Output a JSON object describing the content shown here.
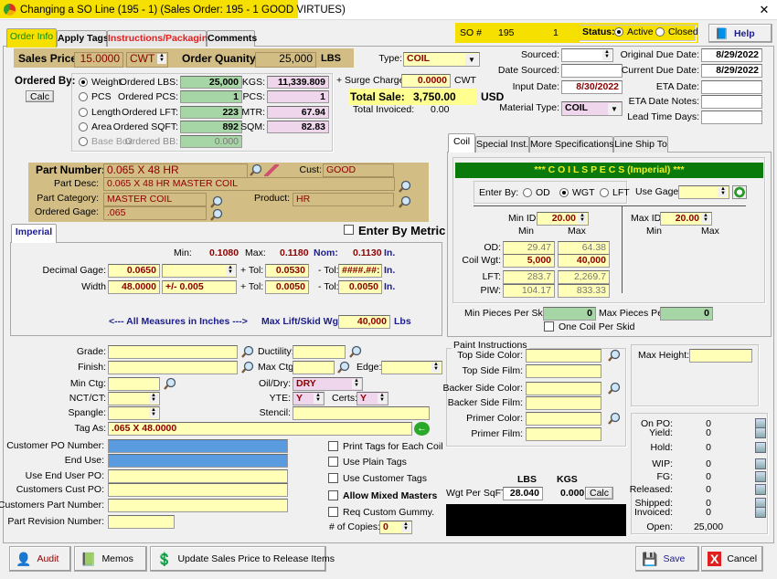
{
  "window": {
    "title": "Changing a SO Line  (195 - 1)  (Sales Order: 195 - 1    GOOD VIRTUES)",
    "close": "✕"
  },
  "tabs": [
    "Order Info",
    "Apply Tags",
    "Instructions/Packaging",
    "Comments"
  ],
  "so": {
    "label": "SO #",
    "number": "195",
    "line": "1",
    "status_label": "Status:",
    "active": "Active",
    "closed": "Closed",
    "status": "Active"
  },
  "help": "Help",
  "price": {
    "sales_price_label": "Sales Price:",
    "sales_price": "15.0000",
    "unit": "CWT",
    "qty_label": "Order Quanity:",
    "qty": "25,000",
    "qty_unit": "LBS"
  },
  "type": {
    "label": "Type:",
    "value": "COIL"
  },
  "ordered_by": {
    "label": "Ordered By:",
    "calc": "Calc",
    "selected": "Weight",
    "rows": [
      {
        "option": "Weight",
        "label": "Ordered LBS:",
        "value": "25,000",
        "metric_label": "KGS:",
        "metric": "11,339.809"
      },
      {
        "option": "PCS",
        "label": "Ordered PCS:",
        "value": "1",
        "metric_label": "PCS:",
        "metric": "1"
      },
      {
        "option": "Length",
        "label": "Ordered LFT:",
        "value": "223",
        "metric_label": "MTR:",
        "metric": "67.94"
      },
      {
        "option": "Area",
        "label": "Ordered SQFT:",
        "value": "892",
        "metric_label": "SQM:",
        "metric": "82.83"
      },
      {
        "option": "Base Box",
        "label": "Ordered BB:",
        "value": "0.000"
      }
    ]
  },
  "totals": {
    "surge_label": "+ Surge Charge:",
    "surge": "0.0000",
    "surge_unit": "CWT",
    "total_label": "Total Sale:",
    "total": "3,750.00",
    "currency": "USD",
    "invoiced_label": "Total Invoiced:",
    "invoiced": "0.00"
  },
  "dates": {
    "sourced_label": "Sourced:",
    "sourced": "",
    "date_sourced_label": "Date Sourced:",
    "date_sourced": "",
    "input_label": "Input Date:",
    "input": "8/30/2022",
    "material_label": "Material Type:",
    "material": "COIL",
    "orig_due_label": "Original Due Date:",
    "orig_due": "8/29/2022",
    "cur_due_label": "Current Due Date:",
    "cur_due": "8/29/2022",
    "eta_label": "ETA Date:",
    "eta": "",
    "eta_notes_label": "ETA Date Notes:",
    "eta_notes": "",
    "lead_label": "Lead Time Days:",
    "lead": ""
  },
  "part": {
    "number_label": "Part Number:",
    "number": "0.065 X 48 HR",
    "cust_label": "Cust:",
    "cust": "GOOD",
    "desc_label": "Part Desc:",
    "desc": "0.065 X 48 HR MASTER COIL",
    "category_label": "Part Category:",
    "category": "MASTER COIL",
    "product_label": "Product:",
    "product": "HR",
    "gage_label": "Ordered Gage:",
    "gage": ".065"
  },
  "metric": {
    "label": "Enter By Metric",
    "checked": false
  },
  "imperial": {
    "tab": "Imperial",
    "min_label": "Min:",
    "min": "0.1080",
    "max_label": "Max:",
    "max": "0.1180",
    "nom_label": "Nom:",
    "nom": "0.1130",
    "unit": "In.",
    "gage_label": "Decimal Gage:",
    "gage": "0.0650",
    "gage_tol_sel": "",
    "ptol_label": "+ Tol:",
    "gage_ptol": "0.0530",
    "mtol_label": "- Tol:",
    "gage_mtol": "####.##:",
    "width_label": "Width",
    "width": "48.0000",
    "width_tol_sel": "+/- 0.005",
    "width_ptol": "0.0050",
    "width_mtol": "0.0050",
    "measures_note": "<---  All Measures in Inches  --->",
    "maxlift_label": "Max Lift/Skid Wgt:",
    "maxlift": "40,000",
    "maxlift_unit": "Lbs"
  },
  "coil_tabs": [
    "Coil",
    "Special Inst.",
    "More Specifications",
    "Line Ship To"
  ],
  "coil": {
    "header": "***   C O I L    S P E C S   (Imperial)   ***",
    "enter_by_label": "Enter By:",
    "options": [
      "OD",
      "WGT",
      "LFT"
    ],
    "selected": "WGT",
    "use_gage_label": "Use Gage:",
    "use_gage": "",
    "min_id_label": "Min ID:",
    "min_id": "20.00",
    "max_id_label": "Max ID:",
    "max_id": "20.00",
    "min": "Min",
    "max": "Max",
    "rows": [
      {
        "label": "OD:",
        "min": "29.47",
        "max": "64.38"
      },
      {
        "label": "Coil Wgt:",
        "min": "5,000",
        "max": "40,000"
      },
      {
        "label": "LFT:",
        "min": "283.7",
        "max": "2,269.7"
      },
      {
        "label": "PIW:",
        "min": "104.17",
        "max": "833.33"
      }
    ],
    "min_pcs_label": "Min Pieces Per Skid:",
    "min_pcs": "0",
    "max_pcs_label": "Max Pieces Per",
    "max_pcs": "0",
    "one_coil_label": "One Coil Per Skid"
  },
  "specs": {
    "grade_label": "Grade:",
    "grade": "",
    "ductility_label": "Ductility:",
    "ductility": "",
    "finish_label": "Finish:",
    "finish": "",
    "maxctg_label": "Max Ctg:",
    "maxctg": "",
    "edge_label": "Edge:",
    "edge": "",
    "minctg_label": "Min Ctg:",
    "minctg": "",
    "oildry_label": "Oil/Dry:",
    "oildry": "DRY",
    "nct_label": "NCT/CT:",
    "nct": "",
    "yte_label": "YTE:",
    "yte": "Y",
    "certs_label": "Certs:",
    "certs": "Y",
    "spangle_label": "Spangle:",
    "spangle": "",
    "stencil_label": "Stencil:",
    "stencil": "",
    "tagas_label": "Tag As:",
    "tagas": ".065 X 48.0000"
  },
  "customer": {
    "po_label": "Customer PO Number:",
    "po": "",
    "enduse_label": "End Use:",
    "enduse": "",
    "enduser_po_label": "Use End User PO:",
    "enduser_po": "",
    "cust_po_label": "Customers Cust PO:",
    "cust_po": "",
    "part_label": "Customers Part Number:",
    "part": "",
    "rev_label": "Part Revision Number:",
    "rev": ""
  },
  "checks": {
    "print_tags": "Print Tags for Each Coil",
    "plain_tags": "Use Plain Tags",
    "cust_tags": "Use Customer Tags",
    "mixed": "Allow Mixed Masters",
    "gummy": "Req Custom Gummy.",
    "copies_label": "# of Copies:",
    "copies": "0"
  },
  "paint": {
    "title": "Paint Instructions",
    "top_color_label": "Top Side Color:",
    "top_film_label": "Top Side Film:",
    "back_color_label": "Backer Side Color:",
    "back_film_label": "Backer Side Film:",
    "primer_color_label": "Primer Color:",
    "primer_film_label": "Primer Film:"
  },
  "maxheight": {
    "label": "Max Height:",
    "value": ""
  },
  "weight": {
    "lbs": "LBS",
    "kgs": "KGS",
    "label": "Wgt Per SqFT:",
    "lbs_value": "28.040",
    "kgs_value": "0.000",
    "calc": "Calc"
  },
  "counts": [
    {
      "label": "On PO:",
      "value": "0"
    },
    {
      "label": "Yield:",
      "value": "0"
    },
    {
      "label": "Hold:",
      "value": "0"
    },
    {
      "label": "WIP:",
      "value": "0"
    },
    {
      "label": "FG:",
      "value": "0"
    },
    {
      "label": "Released:",
      "value": "0"
    },
    {
      "label": "Shipped:",
      "value": "0"
    },
    {
      "label": "Invoiced:",
      "value": "0"
    },
    {
      "label": "Open:",
      "value": "25,000"
    }
  ],
  "footer": {
    "audit": "Audit",
    "memos": "Memos",
    "update": "Update Sales Price to Release Items",
    "save": "Save",
    "cancel": "Cancel"
  },
  "colors": {
    "title_highlight": "#f5e000",
    "tan": "#d2bd85",
    "field_yellow": "#ffffb8",
    "field_green": "#a6d6a6",
    "field_pink": "#f0d6ec",
    "field_blue": "#5a9be0",
    "coil_header": "#0a7a0a"
  }
}
